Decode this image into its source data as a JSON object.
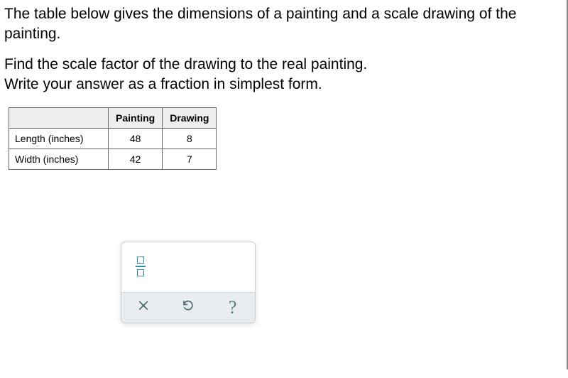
{
  "problem": {
    "intro": "The table below gives the dimensions of a painting and a scale drawing of the painting.",
    "task_line1": "Find the scale factor of the drawing to the real painting.",
    "task_line2": "Write your answer as a fraction in simplest form."
  },
  "table": {
    "headers": {
      "col1": "Painting",
      "col2": "Drawing"
    },
    "rows": [
      {
        "label": "Length (inches)",
        "c1": "48",
        "c2": "8"
      },
      {
        "label": "Width (inches)",
        "c1": "42",
        "c2": "7"
      }
    ]
  },
  "toolbar": {
    "fraction_tool": "fraction-input",
    "clear": "×",
    "undo": "↶",
    "help": "?"
  }
}
